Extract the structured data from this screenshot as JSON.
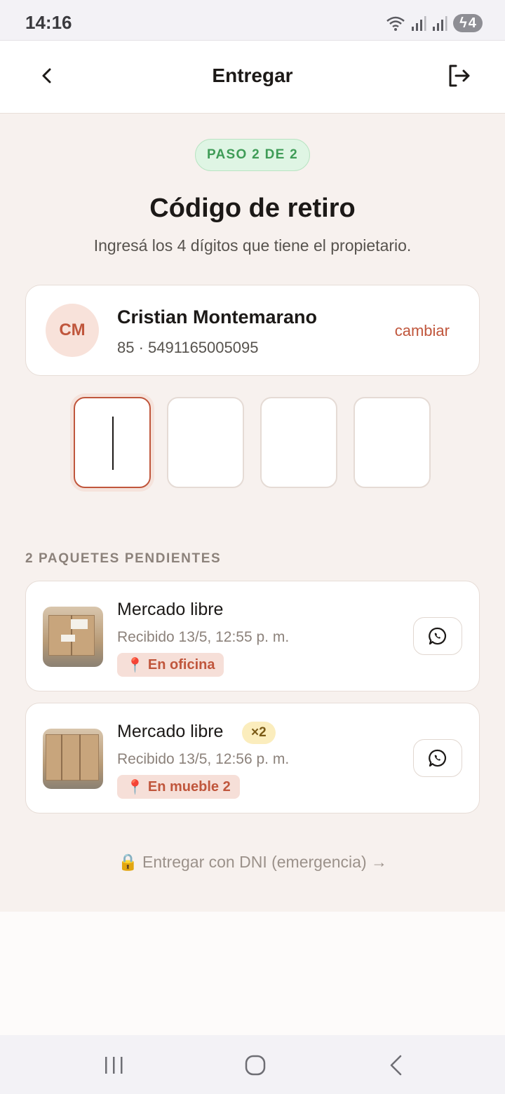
{
  "status_bar": {
    "time": "14:16",
    "battery": "4",
    "icons": [
      "wifi-icon",
      "signal-icon",
      "signal-icon",
      "battery-charging-icon"
    ]
  },
  "header": {
    "title": "Entregar",
    "back_icon": "chevron-left-icon",
    "logout_icon": "logout-icon"
  },
  "step": {
    "label": "PASO 2 DE 2"
  },
  "main": {
    "title": "Código de retiro",
    "subtitle": "Ingresá los 4 dígitos que tiene el propietario."
  },
  "owner": {
    "initials": "CM",
    "name": "Cristian Montemarano",
    "details": "85 · 5491165005095",
    "change_label": "cambiar"
  },
  "code_inputs": [
    "",
    "",
    "",
    ""
  ],
  "packages": {
    "section_label": "2 PAQUETES PENDIENTES",
    "items": [
      {
        "title": "Mercado libre",
        "quantity": "",
        "received": "Recibido 13/5, 12:55 p. m.",
        "location": "En oficina",
        "location_icon": "📍"
      },
      {
        "title": "Mercado libre",
        "quantity": "×2",
        "received": "Recibido 13/5, 12:56 p. m.",
        "location": "En mueble 2",
        "location_icon": "📍"
      }
    ]
  },
  "dni_link": "🔒 Entregar con DNI (emergencia) →",
  "colors": {
    "accent": "#c0563c",
    "success": "#3f9c57",
    "background": "#f7f1ee"
  }
}
